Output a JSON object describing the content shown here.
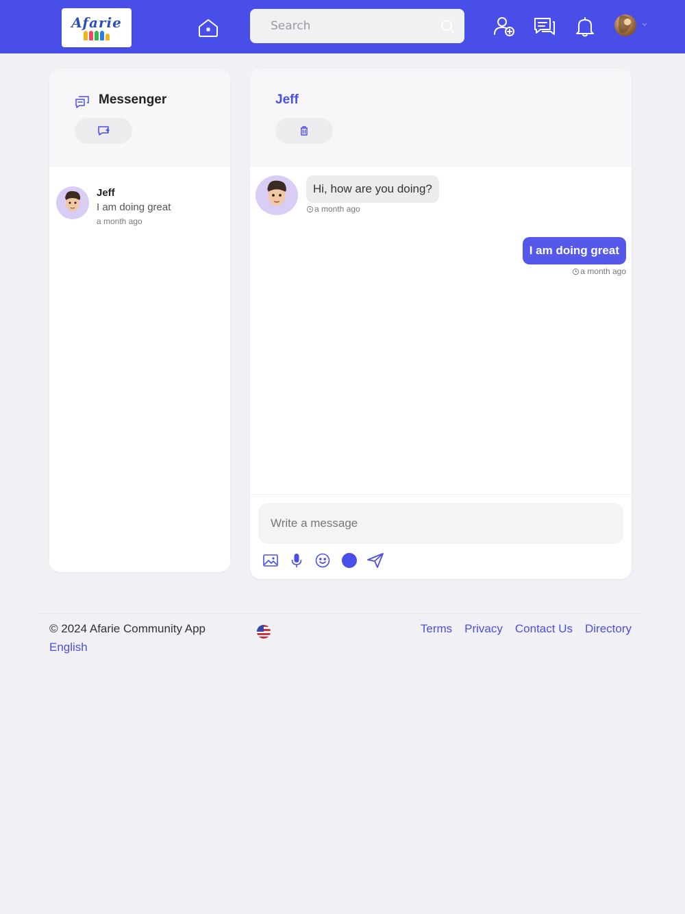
{
  "header": {
    "logo_text": "Afarie",
    "search_placeholder": "Search",
    "brand_color": "#4a4ee8"
  },
  "sidebar": {
    "title": "Messenger",
    "conversations": [
      {
        "name": "Jeff",
        "preview": "I am doing great",
        "time": "a month ago"
      }
    ]
  },
  "chat": {
    "title": "Jeff",
    "messages": [
      {
        "direction": "incoming",
        "text": "Hi, how are you doing?",
        "time": "a month ago"
      },
      {
        "direction": "outgoing",
        "text": "I am doing great",
        "time": "a month ago"
      }
    ],
    "input_placeholder": "Write a message",
    "tools": [
      "image-icon",
      "microphone-icon",
      "smile-icon",
      "color-dot-icon",
      "send-icon"
    ]
  },
  "footer": {
    "copyright": "© 2024 Afarie Community App",
    "language": "English",
    "links": [
      "Terms",
      "Privacy",
      "Contact Us",
      "Directory"
    ]
  }
}
